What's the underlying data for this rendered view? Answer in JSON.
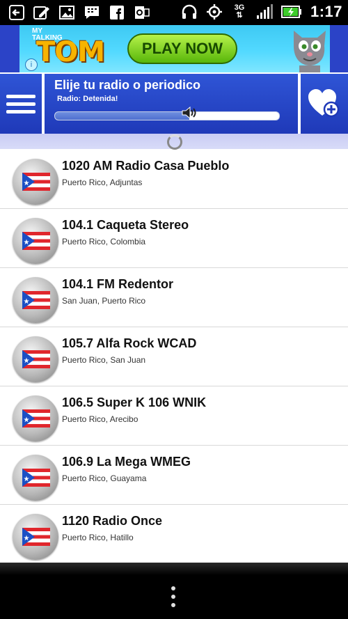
{
  "status_bar": {
    "time": "1:17",
    "network": "3G",
    "notification_icons": [
      "back-arrow-icon",
      "edit-icon",
      "image-icon",
      "bbm-icon",
      "facebook-icon",
      "outlook-icon"
    ],
    "system_icons": [
      "headset-icon",
      "gps-icon",
      "3g-icon",
      "signal-icon",
      "battery-charging-icon"
    ]
  },
  "ad": {
    "logo_small": "MY TALKING",
    "logo_big": "TOM",
    "play_label": "PLAY NOW",
    "info_glyph": "i",
    "bg_color": "#52d9ff"
  },
  "header": {
    "title": "Elije tu radio o periodico",
    "status": "Radio: Detenida!",
    "volume_level": 0.6,
    "accent_color": "#2f55d6"
  },
  "stations": [
    {
      "name": "1020 AM Radio Casa Pueblo",
      "location": "Puerto Rico, Adjuntas"
    },
    {
      "name": "104.1 Caqueta Stereo",
      "location": "Puerto Rico, Colombia"
    },
    {
      "name": "104.1 FM Redentor",
      "location": "San Juan, Puerto Rico"
    },
    {
      "name": "105.7 Alfa Rock WCAD",
      "location": "Puerto Rico, San Juan"
    },
    {
      "name": "106.5 Super K 106 WNIK",
      "location": "Puerto Rico, Arecibo"
    },
    {
      "name": "106.9 La Mega WMEG",
      "location": "Puerto Rico, Guayama"
    },
    {
      "name": "1120 Radio Once",
      "location": "Puerto Rico, Hatillo"
    }
  ]
}
